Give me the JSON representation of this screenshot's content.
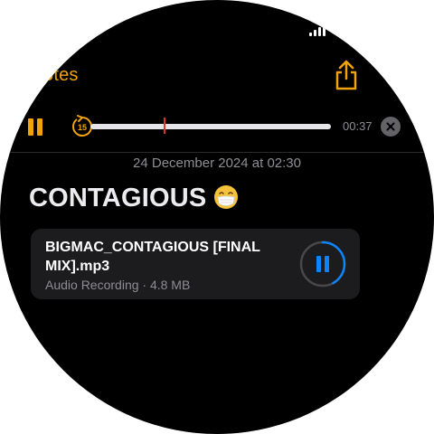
{
  "nav": {
    "back_label": "otes"
  },
  "player": {
    "elapsed": "00:37",
    "progress_fraction": 0.31,
    "skip_seconds": "15"
  },
  "note": {
    "date": "24 December 2024 at 02:30",
    "title": "CONTAGIOUS",
    "title_emoji": "face-with-medical-mask"
  },
  "attachment": {
    "file_name": "BIGMAC_CONTAGIOUS [FINAL MIX].mp3",
    "meta": "Audio Recording · 4.8 MB",
    "progress_fraction": 0.42
  },
  "colors": {
    "accent": "#f0a30a",
    "playhead": "#e0322a",
    "attachment_accent": "#0a84ff"
  },
  "icons": [
    "share-icon",
    "pause-icon",
    "skip-back-15-icon",
    "close-icon",
    "face-with-medical-mask-emoji"
  ]
}
